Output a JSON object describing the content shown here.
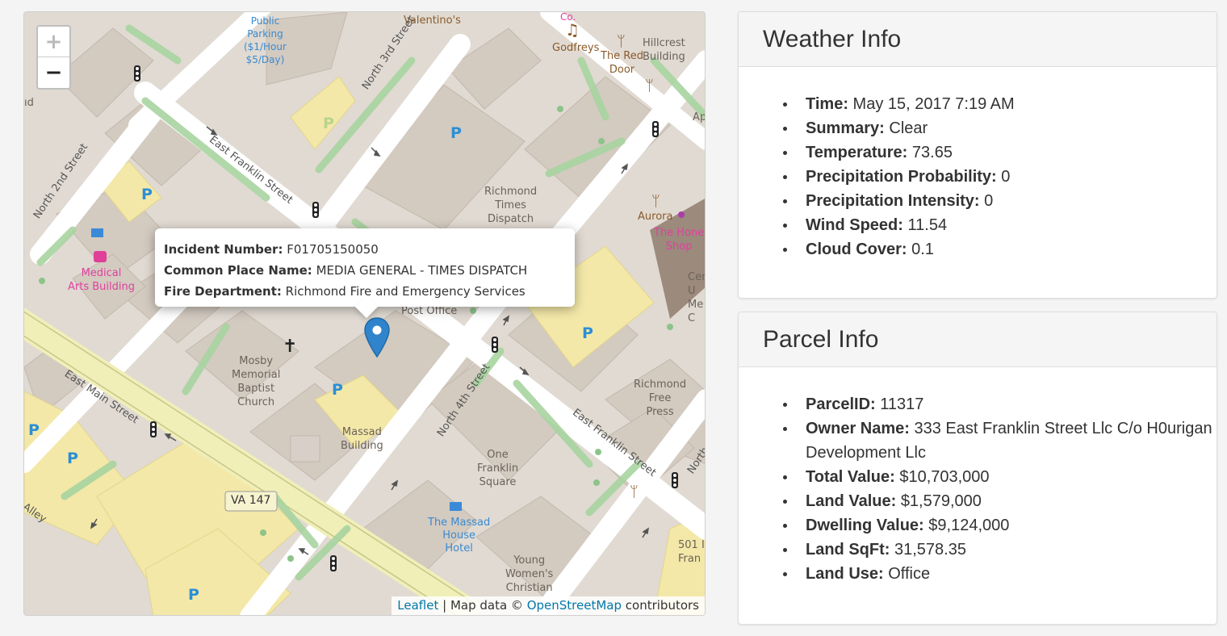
{
  "map": {
    "zoom_in": "+",
    "zoom_out": "−",
    "labels": {
      "public_parking": [
        "Public",
        "Parking",
        "($1/Hour",
        "$5/Day)"
      ],
      "valentinos": "Valentino's",
      "co": "Co.",
      "godfreys": "Godfreys",
      "the_red_door": [
        "The Red",
        "Door"
      ],
      "hillcrest": [
        "Hillcrest",
        "Building"
      ],
      "ap": "Ap",
      "north_3rd": "North 3rd Street",
      "east_franklin_1": "East Franklin Street",
      "north_2nd": "North 2nd Street",
      "rtd": [
        "Richmond",
        "Times",
        "Dispatch"
      ],
      "aurora": "Aurora",
      "honey_shop": [
        "The Hone",
        "Shop"
      ],
      "medical": [
        "Medical",
        "Arts Building"
      ],
      "cen": [
        "Cen",
        "U",
        "Me",
        "C"
      ],
      "post_office": "Post Office",
      "mosby": [
        "Mosby",
        "Memorial",
        "Baptist",
        "Church"
      ],
      "east_main": "East Main Street",
      "north_4th": "North 4th Street",
      "massad_building": [
        "Massad",
        "Building"
      ],
      "richmond_free_press": [
        "Richmond",
        "Free",
        "Press"
      ],
      "east_franklin_2": "East Franklin Street",
      "north": "North",
      "one_franklin": [
        "One",
        "Franklin",
        "Square"
      ],
      "va147": "VA 147",
      "alley": "h Alley",
      "massad_house": [
        "The Massad",
        "House",
        "Hotel"
      ],
      "young": [
        "Young",
        "Women's",
        "Christian"
      ],
      "fran": [
        "501 I",
        "Fran"
      ],
      "ud": "ıd",
      "p": "P"
    },
    "popup": {
      "incident_label": "Incident Number:",
      "incident_value": "F01705150050",
      "place_label": "Common Place Name:",
      "place_value": "MEDIA GENERAL - TIMES DISPATCH",
      "dept_label": "Fire Department:",
      "dept_value": "Richmond Fire and Emergency Services"
    },
    "attribution": {
      "leaflet": "Leaflet",
      "sep": " | Map data © ",
      "osm": "OpenStreetMap",
      "tail": " contributors"
    }
  },
  "weather": {
    "title": "Weather Info",
    "items": [
      {
        "label": "Time:",
        "value": "May 15, 2017 7:19 AM"
      },
      {
        "label": "Summary:",
        "value": "Clear"
      },
      {
        "label": "Temperature:",
        "value": "73.65"
      },
      {
        "label": "Precipitation Probability:",
        "value": "0"
      },
      {
        "label": "Precipitation Intensity:",
        "value": "0"
      },
      {
        "label": "Wind Speed:",
        "value": "11.54"
      },
      {
        "label": "Cloud Cover:",
        "value": "0.1"
      }
    ]
  },
  "parcel": {
    "title": "Parcel Info",
    "items": [
      {
        "label": "ParcelID:",
        "value": "11317"
      },
      {
        "label": "Owner Name:",
        "value": "333 East Franklin Street Llc C/o H0urigan Development Llc"
      },
      {
        "label": "Total Value:",
        "value": "$10,703,000"
      },
      {
        "label": "Land Value:",
        "value": "$1,579,000"
      },
      {
        "label": "Dwelling Value:",
        "value": "$9,124,000"
      },
      {
        "label": "Land SqFt:",
        "value": "31,578.35"
      },
      {
        "label": "Land Use:",
        "value": "Office"
      }
    ]
  }
}
